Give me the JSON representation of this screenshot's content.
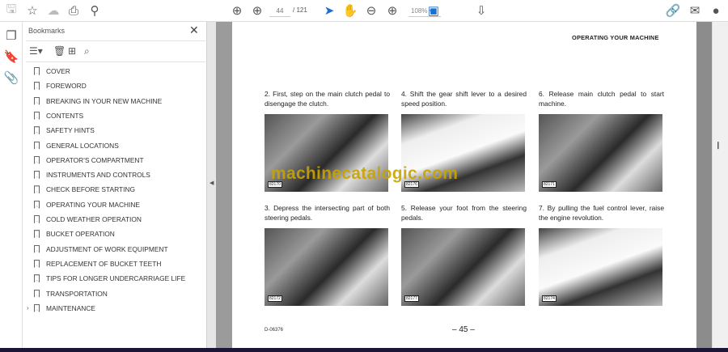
{
  "toolbar": {
    "page_current": "44",
    "page_total": "/ 121",
    "zoom": "108%"
  },
  "bookmarks": {
    "title": "Bookmarks",
    "items": [
      {
        "label": "COVER"
      },
      {
        "label": "FOREWORD"
      },
      {
        "label": "BREAKING IN YOUR NEW MACHINE"
      },
      {
        "label": "CONTENTS"
      },
      {
        "label": "SAFETY HINTS"
      },
      {
        "label": "GENERAL LOCATIONS"
      },
      {
        "label": "OPERATOR'S COMPARTMENT"
      },
      {
        "label": "INSTRUMENTS AND CONTROLS"
      },
      {
        "label": "CHECK BEFORE STARTING"
      },
      {
        "label": "OPERATING YOUR MACHINE"
      },
      {
        "label": "COLD WEATHER OPERATION"
      },
      {
        "label": "BUCKET OPERATION"
      },
      {
        "label": "ADJUSTMENT OF WORK EQUIPMENT"
      },
      {
        "label": "REPLACEMENT OF BUCKET TEETH"
      },
      {
        "label": "TIPS FOR LONGER UNDERCARRIAGE LIFE"
      },
      {
        "label": "TRANSPORTATION"
      },
      {
        "label": "MAINTENANCE"
      }
    ]
  },
  "page": {
    "header": "OPERATING YOUR MACHINE",
    "steps": [
      {
        "text": "2. First, step on the main clutch pedal to disengage the clutch.",
        "photo": "82170"
      },
      {
        "text": "4. Shift the gear shift lever to a desired speed position.",
        "photo": "82176"
      },
      {
        "text": "6. Release main clutch pedal to start machine.",
        "photo": "82171"
      },
      {
        "text": "3. Depress the intersecting part of both steering pedals.",
        "photo": "82172"
      },
      {
        "text": "5. Release your foot from the steering pedals.",
        "photo": "82177"
      },
      {
        "text": "7. By pulling the fuel control lever, raise the engine revolution.",
        "photo": "82174"
      }
    ],
    "watermark": "machinecatalogic.com",
    "doc_code": "D-06376",
    "page_number": "– 45 –"
  }
}
